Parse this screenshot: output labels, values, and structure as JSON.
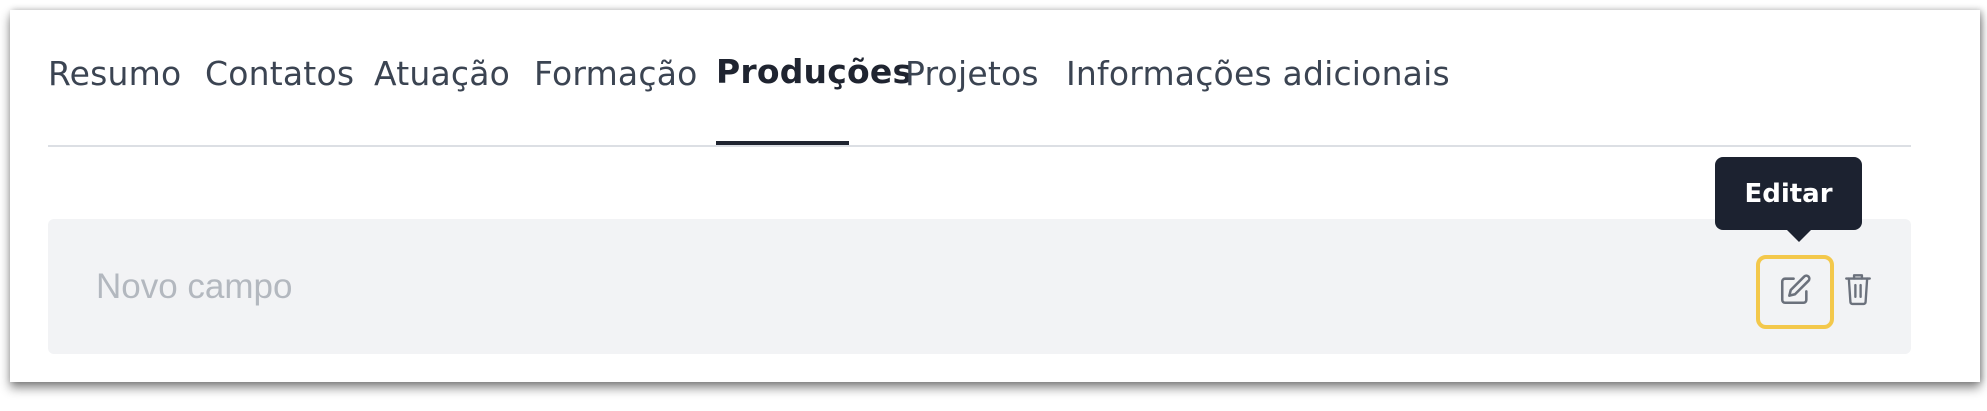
{
  "tabs": [
    {
      "label": "Resumo"
    },
    {
      "label": "Contatos"
    },
    {
      "label": "Atuação"
    },
    {
      "label": "Formação"
    },
    {
      "label": "Produções",
      "active": true
    },
    {
      "label": "Projetos"
    },
    {
      "label": "Informações adicionais"
    }
  ],
  "field": {
    "placeholder": "Novo campo",
    "edit_icon": "edit-icon",
    "delete_icon": "trash-icon"
  },
  "tooltip": {
    "text": "Editar"
  },
  "colors": {
    "highlight": "#f3c84b",
    "tooltip_bg": "#1c2230",
    "field_bg": "#f2f3f5",
    "active_tab": "#1f2430"
  }
}
